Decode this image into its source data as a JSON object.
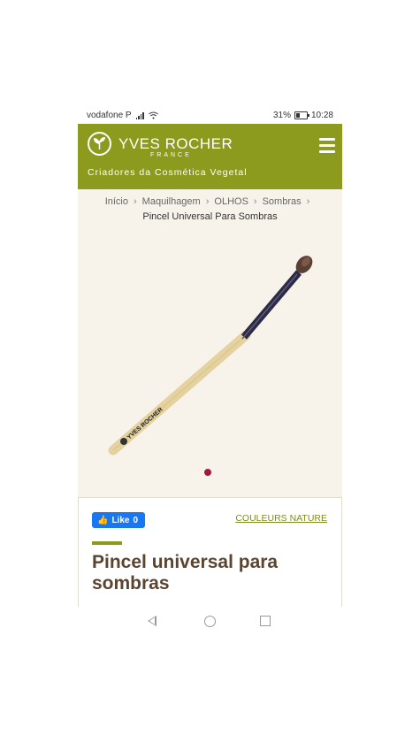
{
  "status_bar": {
    "carrier": "vodafone P",
    "battery": "31%",
    "time": "10:28",
    "icons": [
      "signal-icon",
      "wifi-icon",
      "battery-icon"
    ]
  },
  "header": {
    "brand": "YVES ROCHER",
    "brand_sub": "FRANCE",
    "tagline": "Criadores da Cosmética Vegetal",
    "brand_color": "#8c9b1e"
  },
  "breadcrumb": {
    "items": [
      "Início",
      "Maquilhagem",
      "OLHOS",
      "Sombras"
    ],
    "current": "Pincel Universal Para Sombras"
  },
  "product_image": {
    "brush_print": "YVES ROCHER",
    "carousel_active": 1
  },
  "details": {
    "like_label": "Like",
    "like_count": "0",
    "collection_link": "COULEURS NATURE",
    "title": "Pincel universal para sombras",
    "title_color": "#5b4530",
    "accent_color": "#a2183f"
  },
  "navbar": {
    "icons": [
      "back-icon",
      "home-icon",
      "recent-apps-icon"
    ]
  }
}
